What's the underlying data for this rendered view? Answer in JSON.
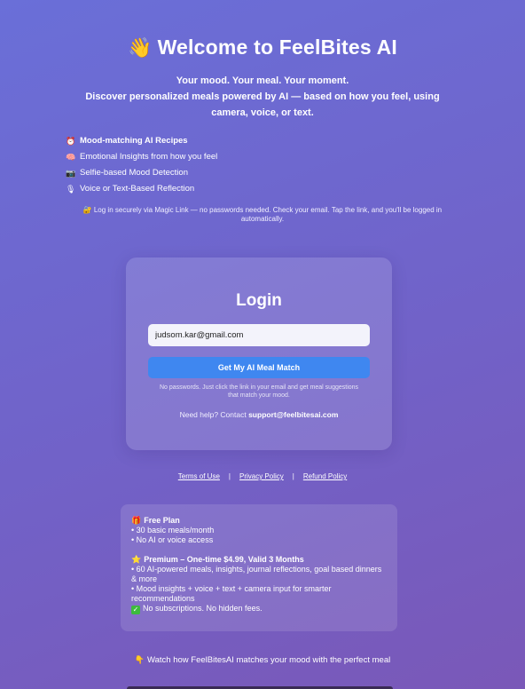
{
  "header": {
    "emoji": "👋",
    "title": "Welcome to FeelBites AI",
    "tagline": "Your mood. Your meal. Your moment.",
    "description": "Discover personalized meals powered by AI — based on how you feel, using camera, voice, or text."
  },
  "features": [
    {
      "icon": "⏰",
      "icon_name": "clock-icon",
      "text": "Mood-matching AI Recipes",
      "bold": true
    },
    {
      "icon": "🧠",
      "icon_name": "brain-icon",
      "text": "Emotional Insights from how you feel",
      "bold": false
    },
    {
      "icon": "📷",
      "icon_name": "camera-icon",
      "text": "Selfie-based Mood Detection",
      "bold": false
    },
    {
      "icon": "🎙",
      "icon_name": "microphone-icon",
      "text": "Voice or Text-Based Reflection",
      "bold": false
    }
  ],
  "magic_link": {
    "icon": "🔐",
    "text": "Log in securely via Magic Link — no passwords needed. Check your email. Tap the link, and you'll be logged in automatically."
  },
  "login": {
    "title": "Login",
    "email_value": "judsom.kar@gmail.com",
    "button_label": "Get My AI Meal Match",
    "note": "No passwords. Just click the link in your email and get meal suggestions that match your mood.",
    "help_prefix": "Need help? Contact ",
    "help_email": "support@feelbitesai.com"
  },
  "footer_links": {
    "terms": "Terms of Use",
    "privacy": "Privacy Policy",
    "refund": "Refund Policy",
    "separator": "|"
  },
  "plans": {
    "free": {
      "icon": "🎁",
      "title": "Free Plan",
      "items": [
        "• 30 basic meals/month",
        "• No AI or voice access"
      ]
    },
    "premium": {
      "icon": "⭐",
      "title": "Premium – One-time $4.99, Valid 3 Months",
      "items": [
        "• 60 AI-powered meals, insights, journal reflections, goal based dinners & more",
        "• Mood insights + voice + text + camera input for smarter recommendations"
      ]
    },
    "guarantee": {
      "icon": "✓",
      "text": "No subscriptions. No hidden fees."
    }
  },
  "watch": {
    "icon": "👇",
    "text": "Watch how FeelBitesAI matches your mood with the perfect meal"
  },
  "colors": {
    "background_start": "#6a6fd8",
    "background_end": "#7a58b8",
    "button": "#3f87f0",
    "check": "#3dbb3d"
  }
}
